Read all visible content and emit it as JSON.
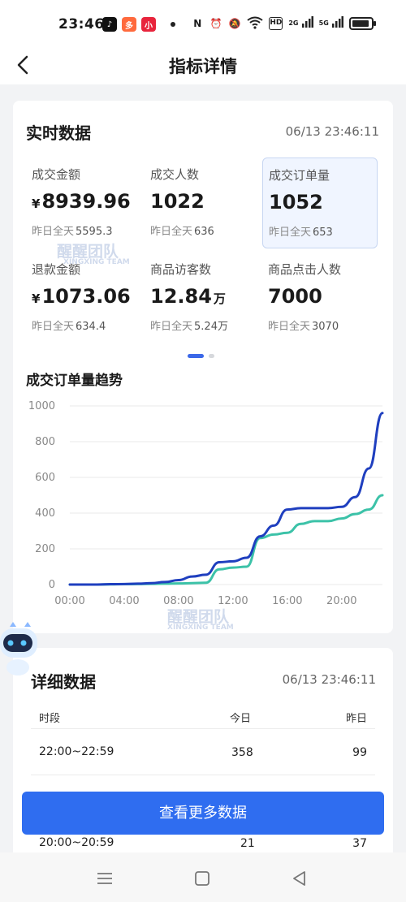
{
  "status_bar": {
    "time": "23:46",
    "app_icons": [
      {
        "icon": "tiktok-icon",
        "glyph": "♪",
        "color": "#111111"
      },
      {
        "icon": "app-icon",
        "glyph": "多",
        "color": "#ff6a3d"
      },
      {
        "icon": "app-icon",
        "glyph": "小",
        "color": "#e8243c"
      }
    ],
    "indicators": [
      "nfc-icon",
      "alarm-icon",
      "mute-icon",
      "wifi-icon",
      "hd-icon",
      "signal-2g-icon",
      "signal-5g-icon",
      "battery-icon"
    ],
    "hd_label": "HD",
    "net1": "2G",
    "net2": "5G"
  },
  "nav": {
    "title": "指标详情",
    "back_icon": "back-arrow-icon"
  },
  "realtime": {
    "title": "实时数据",
    "timestamp": "06/13 23:46:11",
    "metrics": [
      {
        "label": "成交金额",
        "prefix": "¥",
        "value": "8939.96",
        "unit": "",
        "yest_label": "昨日全天",
        "yest_value": "5595.3",
        "selected": false
      },
      {
        "label": "成交人数",
        "prefix": "",
        "value": "1022",
        "unit": "",
        "yest_label": "昨日全天",
        "yest_value": "636",
        "selected": false
      },
      {
        "label": "成交订单量",
        "prefix": "",
        "value": "1052",
        "unit": "",
        "yest_label": "昨日全天",
        "yest_value": "653",
        "selected": true
      },
      {
        "label": "退款金额",
        "prefix": "¥",
        "value": "1073.06",
        "unit": "",
        "yest_label": "昨日全天",
        "yest_value": "634.4",
        "selected": false
      },
      {
        "label": "商品访客数",
        "prefix": "",
        "value": "12.84",
        "unit": "万",
        "yest_label": "昨日全天",
        "yest_value": "5.24万",
        "selected": false
      },
      {
        "label": "商品点击人数",
        "prefix": "",
        "value": "7000",
        "unit": "",
        "yest_label": "昨日全天",
        "yest_value": "3070",
        "selected": false
      }
    ],
    "pager": {
      "pages": 2,
      "active": 0
    }
  },
  "watermark": {
    "title": "醒醒团队",
    "subtitle": "XINGXING TEAM"
  },
  "chart_data": {
    "type": "line",
    "title": "成交订单量趋势",
    "xlabel": "",
    "ylabel": "",
    "x_ticks": [
      "00:00",
      "04:00",
      "08:00",
      "12:00",
      "16:00",
      "20:00"
    ],
    "xlim": [
      0,
      23
    ],
    "ylim": [
      0,
      1000
    ],
    "y_ticks": [
      0,
      200,
      400,
      600,
      800,
      1000
    ],
    "grid": true,
    "series": [
      {
        "color": "#1f3fbf",
        "x": [
          0,
          1,
          2,
          3,
          4,
          5,
          6,
          7,
          8,
          9,
          10,
          11,
          12,
          13,
          14,
          15,
          16,
          17,
          18,
          19,
          20,
          21,
          22,
          23
        ],
        "y": [
          0,
          0,
          0,
          2,
          3,
          5,
          8,
          14,
          25,
          45,
          55,
          125,
          130,
          150,
          270,
          330,
          420,
          428,
          428,
          428,
          435,
          490,
          650,
          960
        ]
      },
      {
        "color": "#3cc2a8",
        "x": [
          0,
          1,
          2,
          3,
          4,
          5,
          6,
          7,
          8,
          9,
          10,
          11,
          12,
          13,
          14,
          15,
          16,
          17,
          18,
          19,
          20,
          21,
          22,
          23
        ],
        "y": [
          0,
          0,
          0,
          1,
          2,
          3,
          4,
          5,
          6,
          8,
          10,
          85,
          95,
          100,
          260,
          280,
          290,
          340,
          355,
          355,
          370,
          395,
          420,
          500
        ]
      }
    ]
  },
  "detail": {
    "title": "详细数据",
    "timestamp": "06/13 23:46:11",
    "columns": [
      "时段",
      "今日",
      "昨日"
    ],
    "rows": [
      {
        "period": "22:00~22:59",
        "today": "358",
        "yesterday": "99"
      },
      {
        "period": "20:00~20:59",
        "today": "21",
        "yesterday": "37"
      }
    ],
    "more_button": "查看更多数据"
  },
  "system_nav": [
    "menu-icon",
    "home-icon",
    "back-icon"
  ]
}
